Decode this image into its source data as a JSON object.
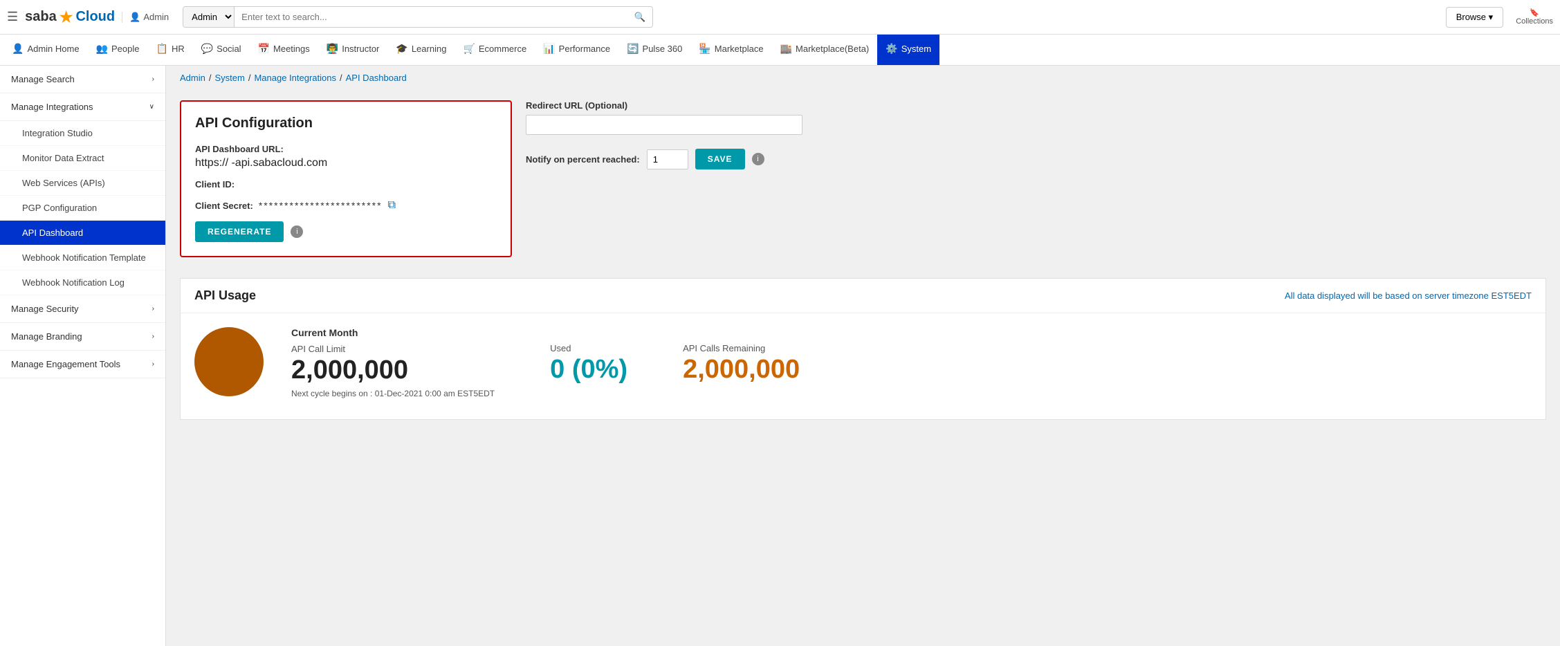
{
  "topbar": {
    "logo_text": "saba",
    "logo_star": "★",
    "logo_cloud": "Cloud",
    "admin_label": "Admin",
    "search_scope": "Admin",
    "search_placeholder": "Enter text to search...",
    "browse_label": "Browse ▾",
    "collections_label": "Collections"
  },
  "nav": {
    "items": [
      {
        "id": "admin-home",
        "icon": "👤",
        "label": "Admin Home",
        "active": false
      },
      {
        "id": "people",
        "icon": "👥",
        "label": "People",
        "active": false
      },
      {
        "id": "hr",
        "icon": "📋",
        "label": "HR",
        "active": false
      },
      {
        "id": "social",
        "icon": "💬",
        "label": "Social",
        "active": false
      },
      {
        "id": "meetings",
        "icon": "📅",
        "label": "Meetings",
        "active": false
      },
      {
        "id": "instructor",
        "icon": "👨‍🏫",
        "label": "Instructor",
        "active": false
      },
      {
        "id": "learning",
        "icon": "🎓",
        "label": "Learning",
        "active": false
      },
      {
        "id": "ecommerce",
        "icon": "🛒",
        "label": "Ecommerce",
        "active": false
      },
      {
        "id": "performance",
        "icon": "📊",
        "label": "Performance",
        "active": false
      },
      {
        "id": "pulse360",
        "icon": "🔄",
        "label": "Pulse 360",
        "active": false
      },
      {
        "id": "marketplace",
        "icon": "🏪",
        "label": "Marketplace",
        "active": false
      },
      {
        "id": "marketplace-beta",
        "icon": "🏬",
        "label": "Marketplace(Beta)",
        "active": false
      },
      {
        "id": "system",
        "icon": "⚙️",
        "label": "System",
        "active": true
      }
    ]
  },
  "sidebar": {
    "items": [
      {
        "id": "manage-search",
        "label": "Manage Search",
        "expanded": false,
        "active": false,
        "level": 0
      },
      {
        "id": "manage-integrations",
        "label": "Manage Integrations",
        "expanded": true,
        "active": false,
        "level": 0
      },
      {
        "id": "integration-studio",
        "label": "Integration Studio",
        "active": false,
        "level": 1
      },
      {
        "id": "monitor-data-extract",
        "label": "Monitor Data Extract",
        "active": false,
        "level": 1
      },
      {
        "id": "web-services",
        "label": "Web Services (APIs)",
        "active": false,
        "level": 1
      },
      {
        "id": "pgp-configuration",
        "label": "PGP Configuration",
        "active": false,
        "level": 1
      },
      {
        "id": "api-dashboard",
        "label": "API Dashboard",
        "active": true,
        "level": 1
      },
      {
        "id": "webhook-notification-template",
        "label": "Webhook Notification Template",
        "active": false,
        "level": 1
      },
      {
        "id": "webhook-notification-log",
        "label": "Webhook Notification Log",
        "active": false,
        "level": 1
      },
      {
        "id": "manage-security",
        "label": "Manage Security",
        "expanded": false,
        "active": false,
        "level": 0
      },
      {
        "id": "manage-branding",
        "label": "Manage Branding",
        "expanded": false,
        "active": false,
        "level": 0
      },
      {
        "id": "manage-engagement-tools",
        "label": "Manage Engagement Tools",
        "expanded": false,
        "active": false,
        "level": 0
      }
    ]
  },
  "breadcrumb": {
    "items": [
      {
        "label": "Admin",
        "link": true
      },
      {
        "label": "System",
        "link": true
      },
      {
        "label": "Manage Integrations",
        "link": true
      },
      {
        "label": "API Dashboard",
        "link": true,
        "current": true
      }
    ]
  },
  "api_config": {
    "title": "API Configuration",
    "url_label": "API Dashboard URL:",
    "url_value": "https://        -api.sabacloud.com",
    "client_id_label": "Client ID:",
    "client_secret_label": "Client Secret:",
    "client_secret_value": "************************",
    "regenerate_label": "REGENERATE",
    "redirect_url_label": "Redirect URL (Optional)",
    "redirect_url_placeholder": "",
    "notify_label": "Notify on percent reached:",
    "notify_value": "1",
    "save_label": "SAVE"
  },
  "api_usage": {
    "title": "API Usage",
    "timezone_note": "All data displayed will be based on server timezone EST5EDT",
    "section_label": "Current Month",
    "call_limit_label": "API Call Limit",
    "call_limit_value": "2,000,000",
    "used_label": "Used",
    "used_value": "0 (0%)",
    "remaining_label": "API Calls Remaining",
    "remaining_value": "2,000,000",
    "next_cycle": "Next cycle begins on : 01-Dec-2021 0:00 am EST5EDT"
  }
}
